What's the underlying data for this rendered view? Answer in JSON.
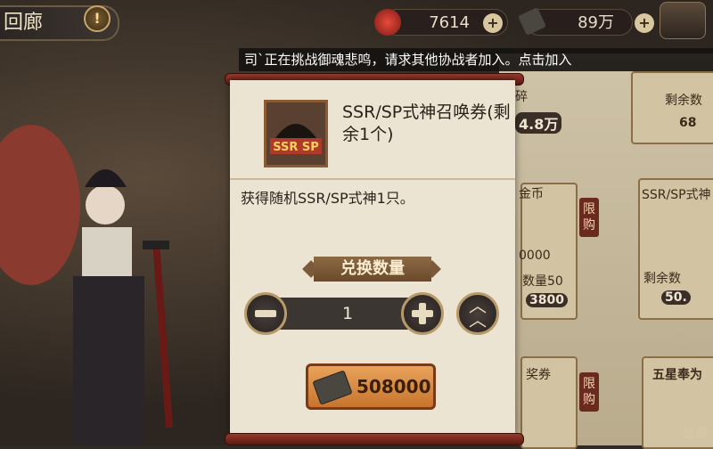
{
  "header": {
    "title": "回廊",
    "alert_icon": "!",
    "currency1_value": "7614",
    "currency2_value": "89万"
  },
  "notice": "司`正在挑战御魂悲鸣，请求其他协战者加入。点击加入",
  "dialog": {
    "item_icon_text": "SSR SP",
    "item_name": "SSR/SP式神召唤券(剩余1个)",
    "description": "获得随机SSR/SP式神1只。",
    "quantity_label": "兑换数量",
    "quantity_value": "1",
    "price": "508000"
  },
  "side": {
    "card1_a": "碎",
    "card1_b": "剩余数",
    "card1_price": "4.8万",
    "card1_val": "68",
    "tag_limit": "限购",
    "card2_title": "金币",
    "card2_val": "0000",
    "card2_count": "数量50",
    "card2_price": "3800",
    "card3_title": "SSR/SP式神",
    "card3_count": "剩余数",
    "card3_price": "50.",
    "card4_title": "奖券",
    "card5_title": "五星奉为"
  },
  "watermark": "亿番"
}
